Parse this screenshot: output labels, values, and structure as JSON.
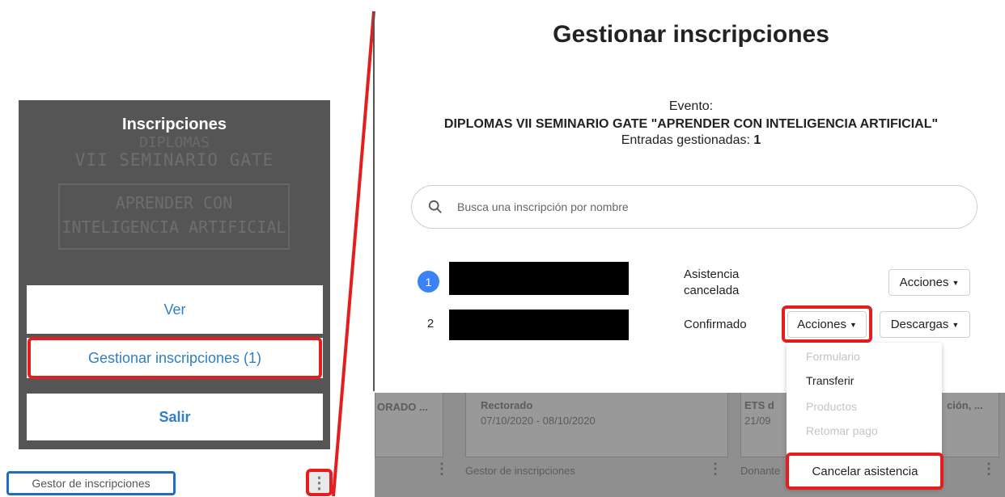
{
  "left_panel": {
    "card_title": "Inscripciones",
    "card_bg_line1": "DIPLOMAS",
    "card_bg_line2": "VII SEMINARIO GATE",
    "card_bg_box_line1": "APRENDER CON",
    "card_bg_box_line2": "INTELIGENCIA ARTIFICIAL",
    "buttons": {
      "ver": "Ver",
      "gestionar": "Gestionar inscripciones (1)",
      "salir": "Salir"
    },
    "gestor_link": "Gestor de inscripciones",
    "kebab": "⋮"
  },
  "modal": {
    "title": "Gestionar inscripciones",
    "evento_label": "Evento:",
    "evento_name": "DIPLOMAS VII SEMINARIO GATE \"APRENDER CON INTELIGENCIA ARTIFICIAL\"",
    "entradas_label": "Entradas gestionadas:",
    "entradas_value": "1",
    "search_placeholder": "Busca una inscripción por nombre",
    "rows": [
      {
        "index": "1",
        "status_line1": "Asistencia",
        "status_line2": "cancelada",
        "acciones": "Acciones"
      },
      {
        "index": "2",
        "status": "Confirmado",
        "acciones": "Acciones",
        "descargas": "Descargas"
      }
    ],
    "dropdown": [
      "Formulario",
      "Transferir",
      "Productos",
      "Retomar pago",
      "Cancelar asistencia"
    ]
  },
  "background": {
    "card1_text": "ORADO ...",
    "card2_title": "Rectorado",
    "card2_dates": "07/10/2020 - 08/10/2020",
    "card3_title": "ETS d",
    "card3_date": "21/09",
    "card3_tail": "ción, ...",
    "footer_gestor": "Gestor de inscripciones",
    "footer_donante": "Donante"
  },
  "colors": {
    "highlight_red": "#e41e1e",
    "link_blue": "#2f7fc2",
    "badge_blue": "#3b82f6",
    "gestor_border": "#1c6fc2"
  }
}
